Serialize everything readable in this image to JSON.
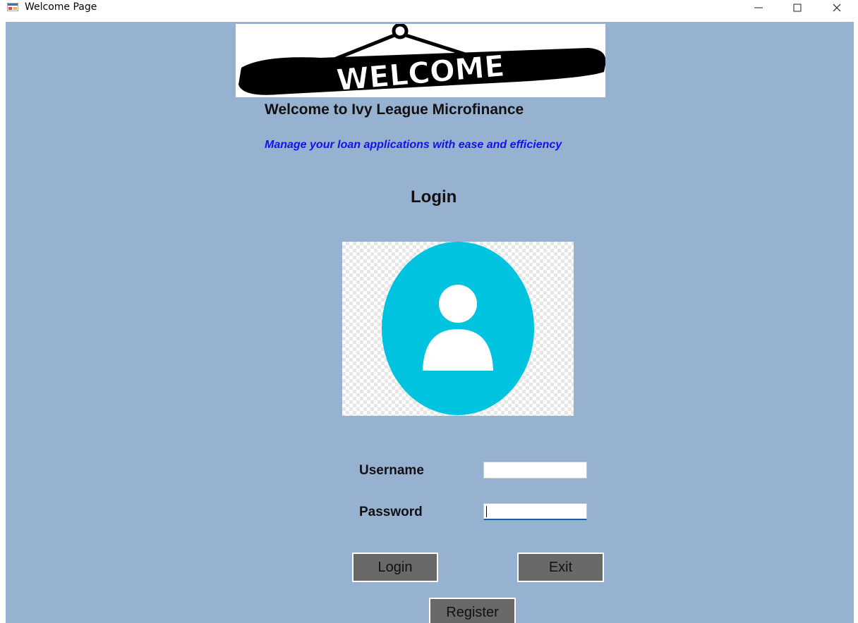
{
  "window": {
    "title": "Welcome Page",
    "minimize_glyph": "—",
    "maximize_glyph": "☐",
    "close_glyph": "✕"
  },
  "banner": {
    "text": "WELCOME"
  },
  "main": {
    "heading": "Welcome to Ivy League Microfinance",
    "tagline": "Manage your loan applications with ease and efficiency",
    "login_title": "Login"
  },
  "form": {
    "username_label": "Username",
    "password_label": "Password",
    "username_value": "",
    "password_value": ""
  },
  "buttons": {
    "login": "Login",
    "exit": "Exit",
    "register": "Register"
  },
  "colors": {
    "client_background": "#97b2d1",
    "tagline": "#1212f0",
    "avatar": "#00c3df",
    "button": "#696969",
    "focus_underline": "#0f5fb8"
  },
  "icons": {
    "app": "app-form-icon",
    "avatar": "user-avatar-icon",
    "banner": "welcome-sign-icon"
  }
}
